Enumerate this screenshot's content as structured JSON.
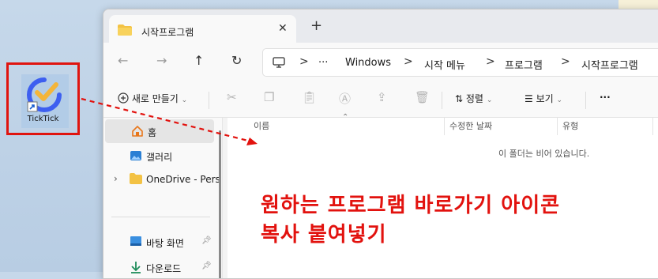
{
  "desktop": {
    "shortcut_label": "TickTick",
    "colors": {
      "highlight_box": "#e0140f",
      "logo_blue": "#3d5ff0",
      "logo_check": "#f4b53a"
    }
  },
  "window": {
    "tab": {
      "title": "시작프로그램",
      "close": "✕"
    },
    "new_tab": "+",
    "nav": {
      "back": "←",
      "forward": "→",
      "up": "↑",
      "refresh": "↻"
    },
    "breadcrumb": {
      "more": "···",
      "items": [
        "Windows",
        "시작 메뉴",
        "프로그램",
        "시작프로그램"
      ],
      "separator": ">"
    },
    "toolbar": {
      "new_label": "새로 만들기",
      "sort_label": "정렬",
      "view_label": "보기",
      "more": "···"
    },
    "sidebar": {
      "items": [
        {
          "label": "홈",
          "icon": "home-icon"
        },
        {
          "label": "갤러리",
          "icon": "gallery-icon"
        },
        {
          "label": "OneDrive - Pers",
          "icon": "folder-icon"
        },
        {
          "label": "바탕 화면",
          "icon": "desktop-icon"
        },
        {
          "label": "다운로드",
          "icon": "download-icon"
        }
      ]
    },
    "columns": [
      "이름",
      "수정한 날짜",
      "유형"
    ],
    "empty_message": "이 폴더는 비어 있습니다."
  },
  "annotation": {
    "line1": "원하는 프로그램 바로가기 아이콘",
    "line2": "복사 붙여넣기",
    "color": "#e2120e"
  }
}
